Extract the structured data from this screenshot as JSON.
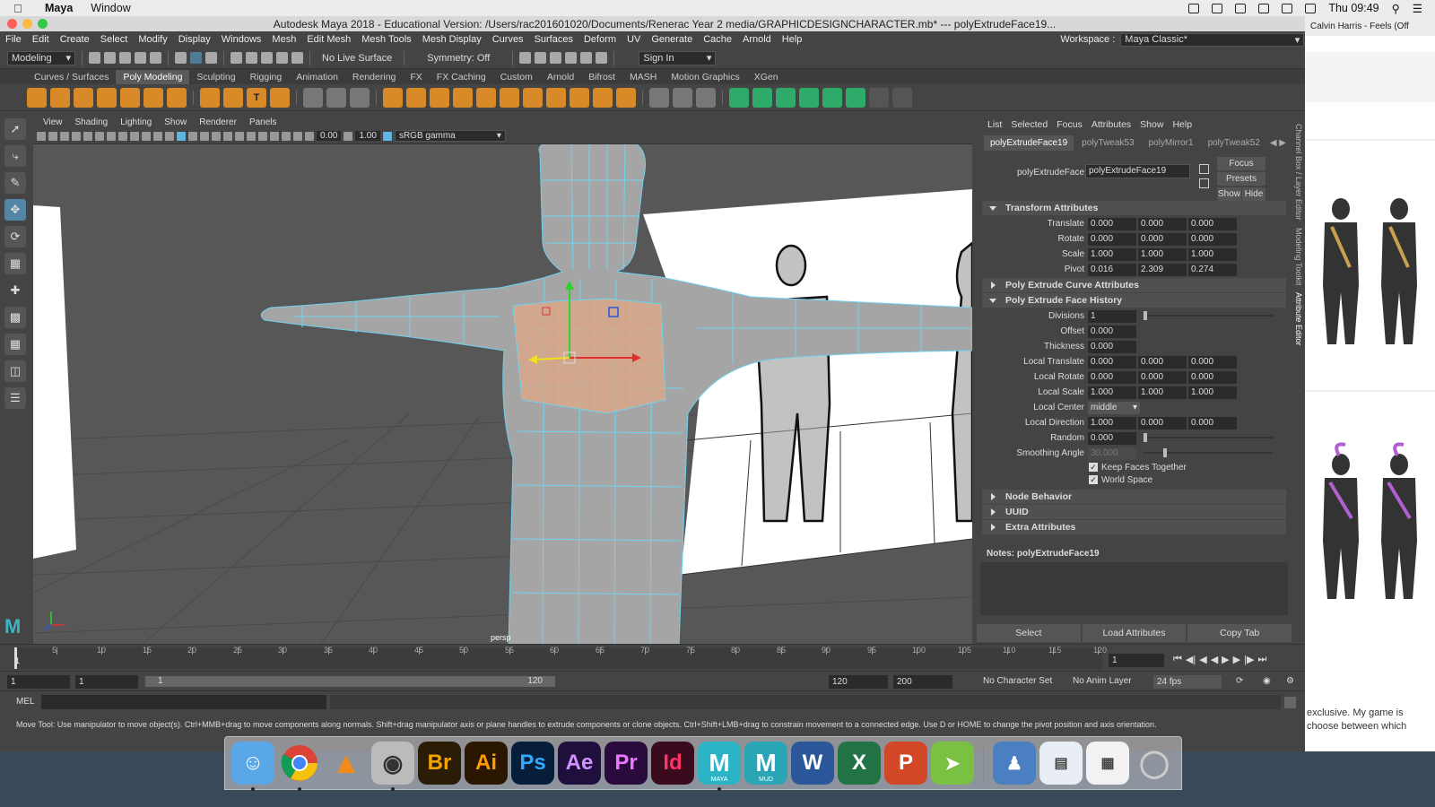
{
  "mac_menubar": {
    "app_name": "Maya",
    "menu": [
      "Window"
    ],
    "clock": "Thu 09:49"
  },
  "window": {
    "title": "Autodesk Maya 2018 - Educational Version: /Users/rac201601020/Documents/Renerac Year 2 media/GRAPHICDESIGNCHARACTER.mb*   ---   polyExtrudeFace19..."
  },
  "main_menu": {
    "items": [
      "File",
      "Edit",
      "Create",
      "Select",
      "Modify",
      "Display",
      "Windows",
      "Mesh",
      "Edit Mesh",
      "Mesh Tools",
      "Mesh Display",
      "Curves",
      "Surfaces",
      "Deform",
      "UV",
      "Generate",
      "Cache",
      "Arnold",
      "Help"
    ],
    "workspace_label": "Workspace :",
    "workspace_value": "Maya Classic*"
  },
  "status_line": {
    "mode": "Modeling",
    "live_surface": "No Live Surface",
    "symmetry": "Symmetry: Off",
    "sign_in": "Sign In"
  },
  "shelf_tabs": {
    "items": [
      "Curves / Surfaces",
      "Poly Modeling",
      "Sculpting",
      "Rigging",
      "Animation",
      "Rendering",
      "FX",
      "FX Caching",
      "Custom",
      "Arnold",
      "Bifrost",
      "MASH",
      "Motion Graphics",
      "XGen"
    ],
    "active_index": 1
  },
  "viewport": {
    "menu": [
      "View",
      "Shading",
      "Lighting",
      "Show",
      "Renderer",
      "Panels"
    ],
    "exposure": "0.00",
    "gamma_value": "1.00",
    "color_space": "sRGB gamma",
    "camera_label": "persp"
  },
  "attribute_editor": {
    "menu": [
      "List",
      "Selected",
      "Focus",
      "Attributes",
      "Show",
      "Help"
    ],
    "node_tabs": [
      "polyExtrudeFace19",
      "polyTweak53",
      "polyMirror1",
      "polyTweak52"
    ],
    "node_label": "polyExtrudeFace:",
    "node_name": "polyExtrudeFace19",
    "buttons": {
      "focus": "Focus",
      "presets": "Presets",
      "show": "Show",
      "hide": "Hide"
    },
    "sections": {
      "transform": "Transform Attributes",
      "curve": "Poly Extrude Curve Attributes",
      "history": "Poly Extrude Face History",
      "node_behavior": "Node Behavior",
      "uuid": "UUID",
      "extra": "Extra Attributes"
    },
    "transform_rows": [
      {
        "label": "Translate",
        "v": [
          "0.000",
          "0.000",
          "0.000"
        ]
      },
      {
        "label": "Rotate",
        "v": [
          "0.000",
          "0.000",
          "0.000"
        ]
      },
      {
        "label": "Scale",
        "v": [
          "1.000",
          "1.000",
          "1.000"
        ]
      },
      {
        "label": "Pivot",
        "v": [
          "0.016",
          "2.309",
          "0.274"
        ]
      }
    ],
    "history_rows": {
      "divisions": {
        "label": "Divisions",
        "v": "1"
      },
      "offset": {
        "label": "Offset",
        "v": "0.000"
      },
      "thickness": {
        "label": "Thickness",
        "v": "0.000"
      },
      "local_translate": {
        "label": "Local Translate",
        "v": [
          "0.000",
          "0.000",
          "0.000"
        ]
      },
      "local_rotate": {
        "label": "Local Rotate",
        "v": [
          "0.000",
          "0.000",
          "0.000"
        ]
      },
      "local_scale": {
        "label": "Local Scale",
        "v": [
          "1.000",
          "1.000",
          "1.000"
        ]
      },
      "local_center": {
        "label": "Local Center",
        "v": "middle"
      },
      "local_direction": {
        "label": "Local Direction",
        "v": [
          "1.000",
          "0.000",
          "0.000"
        ]
      },
      "random": {
        "label": "Random",
        "v": "0.000"
      },
      "smoothing_angle": {
        "label": "Smoothing Angle",
        "v": "30.000"
      }
    },
    "checkboxes": {
      "keep_faces": "Keep Faces Together",
      "world_space": "World Space"
    },
    "notes_label": "Notes:  polyExtrudeFace19",
    "bottom_buttons": [
      "Select",
      "Load Attributes",
      "Copy Tab"
    ]
  },
  "side_tabs": [
    "Channel Box / Layer Editor",
    "Modeling Toolkit",
    "Attribute Editor"
  ],
  "timeline": {
    "ticks": [
      "5",
      "10",
      "15",
      "20",
      "25",
      "30",
      "35",
      "40",
      "45",
      "50",
      "55",
      "60",
      "65",
      "70",
      "75",
      "80",
      "85",
      "90",
      "95",
      "100",
      "105",
      "110",
      "115",
      "120"
    ],
    "start_label": "1",
    "current_frame": "1"
  },
  "range_slider": {
    "start": "1",
    "playback_start": "1",
    "bar_start": "1",
    "bar_end": "120",
    "playback_end": "120",
    "end": "200",
    "character_set": "No Character Set",
    "anim_layer": "No Anim Layer",
    "fps": "24 fps"
  },
  "command_line": {
    "label": "MEL"
  },
  "help_line": "Move Tool: Use manipulator to move object(s). Ctrl+MMB+drag to move components along normals. Shift+drag manipulator axis or plane handles to extrude components or clone objects. Ctrl+Shift+LMB+drag to constrain movement to a connected edge. Use D or HOME to change the pivot position and axis orientation.",
  "background_window": {
    "header": "Calvin Harris - Feels (Off",
    "text_1": "exclusive. My game is",
    "text_2": "choose between which"
  },
  "dock": {
    "items": [
      "Br",
      "Ai",
      "Ps",
      "Ae",
      "Pr",
      "Id",
      "MAYA",
      "MUD"
    ]
  }
}
